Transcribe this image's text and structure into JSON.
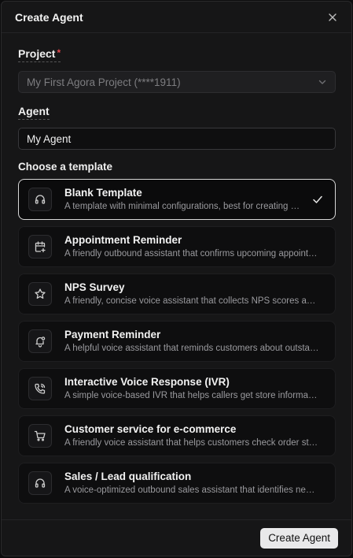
{
  "dialog": {
    "title": "Create Agent",
    "close_icon": "close-icon"
  },
  "project": {
    "label": "Project",
    "required_mark": "*",
    "value": "My First Agora Project (****1911)"
  },
  "agent": {
    "label": "Agent",
    "value": "My Agent"
  },
  "templates": {
    "section_title": "Choose a template",
    "selected_index": 0,
    "items": [
      {
        "name": "Blank Template",
        "description": "A template with minimal configurations, best for creating custom agents",
        "icon": "headset-icon"
      },
      {
        "name": "Appointment Reminder",
        "description": "A friendly outbound assistant that confirms upcoming appointments",
        "icon": "calendar-plus-icon"
      },
      {
        "name": "NPS Survey",
        "description": "A friendly, concise voice assistant that collects NPS scores and open feedback",
        "icon": "star-icon"
      },
      {
        "name": "Payment Reminder",
        "description": "A helpful voice assistant that reminds customers about outstanding payments",
        "icon": "bell-icon"
      },
      {
        "name": "Interactive Voice Response (IVR)",
        "description": "A simple voice-based IVR that helps callers get store information quickly",
        "icon": "phone-call-icon"
      },
      {
        "name": "Customer service for e-commerce",
        "description": "A friendly voice assistant that helps customers check order status and returns",
        "icon": "cart-icon"
      },
      {
        "name": "Sales / Lead qualification",
        "description": "A voice-optimized outbound sales assistant that identifies needs and qualifies leads",
        "icon": "headset-icon"
      }
    ]
  },
  "footer": {
    "create_label": "Create Agent"
  },
  "colors": {
    "background": "#161617",
    "card": "#0e0e0f",
    "selected_border": "#d8d8d8",
    "required": "#e5484d",
    "primary_button": "#e9e9ea"
  }
}
